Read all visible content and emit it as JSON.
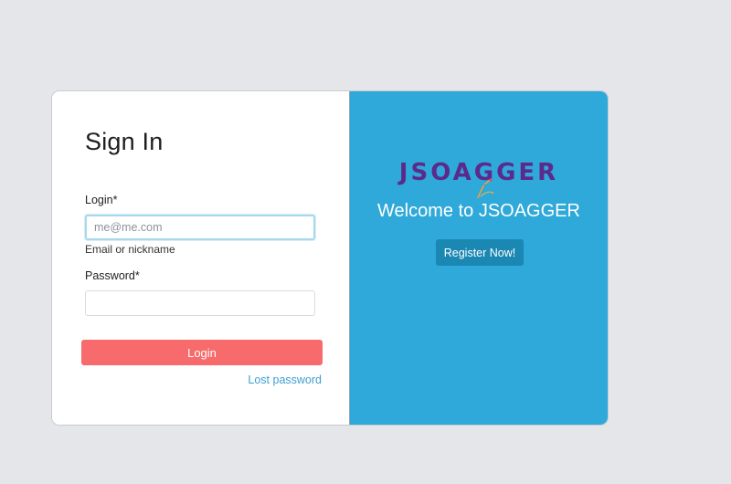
{
  "signin": {
    "title": "Sign In",
    "login_label": "Login*",
    "login_placeholder": "me@me.com",
    "login_value": "",
    "login_hint": "Email or nickname",
    "password_label": "Password*",
    "password_value": "",
    "login_button": "Login",
    "lost_password": "Lost password"
  },
  "welcome": {
    "logo_text_left": "JSOA",
    "logo_text_right": "GGER",
    "logo_icon": "flourish-icon",
    "heading": "Welcome to JSOAGGER",
    "register_button": "Register Now!"
  },
  "colors": {
    "page_bg": "#e4e6e9",
    "right_panel": "#2ea9d9",
    "login_button": "#f76b6c",
    "register_button": "#1b87b3",
    "link": "#3d9fd1",
    "logo": "#5b2a8c"
  }
}
